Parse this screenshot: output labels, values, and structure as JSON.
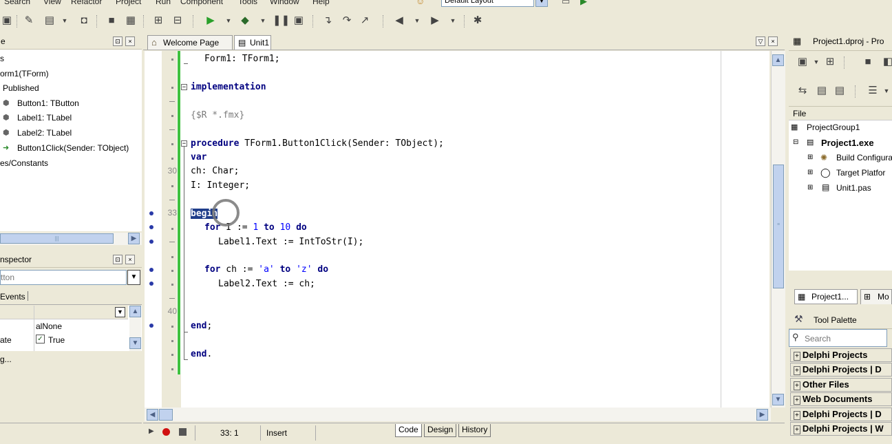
{
  "menu": [
    "Search",
    "View",
    "Refactor",
    "Project",
    "Run",
    "Component",
    "Tools",
    "Window",
    "Help"
  ],
  "layout_combo": "Default Layout",
  "structure": {
    "title": "e",
    "items": [
      "s",
      "orm1(TForm)",
      "Published",
      "Button1: TButton",
      "Label1: TLabel",
      "Label2: TLabel",
      "Button1Click(Sender: TObject)",
      "es/Constants"
    ]
  },
  "inspector": {
    "title": "nspector",
    "object_combo": "tton",
    "events_tab": "Events",
    "rows": [
      {
        "name": "",
        "value": "alNone"
      },
      {
        "name": "ate",
        "value": "True"
      }
    ],
    "bottom_link": "g..."
  },
  "editor": {
    "tabs": [
      "Welcome Page",
      "Unit1"
    ],
    "lines": {
      "l1": "Form1: TForm1;",
      "l2_kw": "implementation",
      "l3": "{$R *.fmx}",
      "l4_kw": "procedure",
      "l4_rest": " TForm1.Button1Click(Sender: TObject);",
      "l5_kw": "var",
      "l6": "ch: Char;",
      "l7": "I: Integer;",
      "l8_kw": "begin",
      "l9_kw1": "for",
      "l9_mid": " I := ",
      "l9_n1": "1",
      "l9_kw2": "to",
      "l9_n2": "10",
      "l9_kw3": "do",
      "l10": "Label1.Text := IntToStr(I);",
      "l11_kw1": "for",
      "l11_mid": " ch := ",
      "l11_s1": "'a'",
      "l11_kw2": "to",
      "l11_s2": "'z'",
      "l11_kw3": "do",
      "l12": "Label2.Text := ch;",
      "l13_kw": "end",
      "l13_rest": ";",
      "l14_kw": "end",
      "l14_rest": "."
    },
    "line_numbers": {
      "n30": "30",
      "n33": "33",
      "n40": "40"
    }
  },
  "status": {
    "position": "33:  1",
    "mode": "Insert",
    "tabs": [
      "Code",
      "Design",
      "History"
    ]
  },
  "project": {
    "title": "Project1.dproj - Pro",
    "file_header": "File",
    "tree": [
      "ProjectGroup1",
      "Project1.exe",
      "Build Configura",
      "Target Platfor",
      "Unit1.pas"
    ],
    "bottom_tabs": [
      "Project1...",
      "Mo"
    ]
  },
  "palette": {
    "title": "Tool Palette",
    "search_placeholder": "Search",
    "sections": [
      "Delphi Projects",
      "Delphi Projects | D",
      "Other Files",
      "Web Documents",
      "Delphi Projects | D",
      "Delphi Projects | W"
    ]
  }
}
